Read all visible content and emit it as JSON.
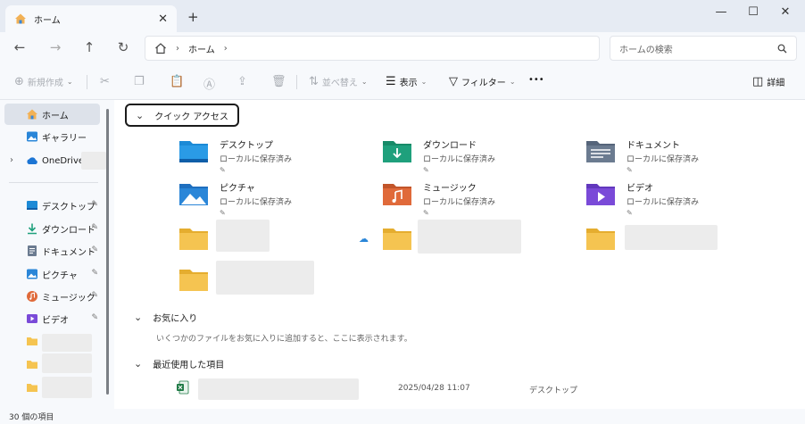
{
  "tab": {
    "title": "ホーム",
    "close": "✕",
    "new": "+"
  },
  "window": {
    "minimize": "—",
    "maximize": "☐",
    "close": "✕"
  },
  "nav": {
    "back": "←",
    "forward": "→",
    "up": "↑",
    "refresh": "↻",
    "breadcrumb": [
      "ホーム"
    ],
    "chev": "›",
    "search_placeholder": "ホームの検索"
  },
  "toolbar": {
    "new": "新規作成",
    "sort": "並べ替え",
    "view": "表示",
    "filter": "フィルター",
    "more": "•••",
    "details": "詳細"
  },
  "sidebar": {
    "top": [
      {
        "label": "ホーム",
        "icon": "home-icon"
      },
      {
        "label": "ギャラリー",
        "icon": "gallery-icon"
      },
      {
        "label": "OneDrive",
        "icon": "cloud-icon"
      }
    ],
    "pinned": [
      {
        "label": "デスクトップ",
        "icon": "desktop-icon"
      },
      {
        "label": "ダウンロード",
        "icon": "download-icon"
      },
      {
        "label": "ドキュメント",
        "icon": "document-icon"
      },
      {
        "label": "ピクチャ",
        "icon": "pictures-icon"
      },
      {
        "label": "ミュージック",
        "icon": "music-icon"
      },
      {
        "label": "ビデオ",
        "icon": "video-icon"
      }
    ],
    "pin_glyph": "📌"
  },
  "main": {
    "quick_access_title": "クイック アクセス",
    "quick_items": [
      {
        "name": "デスクトップ",
        "sub": "ローカルに保存済み",
        "color": "#1c8ad6"
      },
      {
        "name": "ダウンロード",
        "sub": "ローカルに保存済み",
        "color": "#1fa07c"
      },
      {
        "name": "ドキュメント",
        "sub": "ローカルに保存済み",
        "color": "#6b7b90"
      },
      {
        "name": "ピクチャ",
        "sub": "ローカルに保存済み",
        "color": "#2a86d8"
      },
      {
        "name": "ミュージック",
        "sub": "ローカルに保存済み",
        "color": "#e06a3a"
      },
      {
        "name": "ビデオ",
        "sub": "ローカルに保存済み",
        "color": "#7a4ad8"
      }
    ],
    "favorites_title": "お気に入り",
    "favorites_hint": "いくつかのファイルをお気に入りに追加すると、ここに表示されます。",
    "recent_title": "最近使用した項目",
    "recent_items": [
      {
        "date": "2025/04/28 11:07",
        "location": "デスクトップ"
      }
    ]
  },
  "status": {
    "count": "30 個の項目"
  }
}
